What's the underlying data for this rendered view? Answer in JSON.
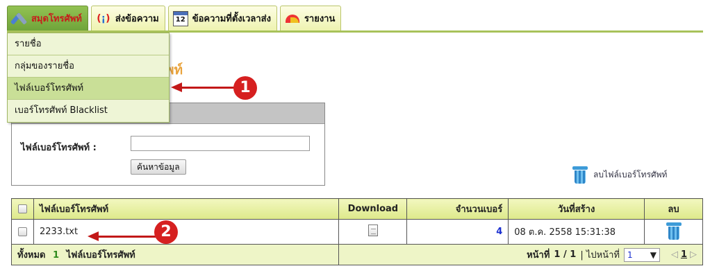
{
  "tabs": [
    {
      "label": "สมุดโทรศัพท์",
      "icon": "tools-icon",
      "active": true
    },
    {
      "label": "ส่งข้อความ",
      "icon": "antenna-icon",
      "active": false
    },
    {
      "label": "ข้อความที่ตั้งเวลาส่ง",
      "icon": "calendar-icon",
      "calendar_day": "12",
      "active": false
    },
    {
      "label": "รายงาน",
      "icon": "chart-icon",
      "active": false
    }
  ],
  "menu": {
    "items": [
      {
        "label": "รายชื่อ"
      },
      {
        "label": "กลุ่มของรายชื่อ"
      },
      {
        "label": "ไฟล์เบอร์โทรศัพท์",
        "highlighted": true
      },
      {
        "label": "เบอร์โทรศัพท์ Blacklist"
      }
    ]
  },
  "page_heading": "พท์",
  "search": {
    "label": "ไฟล์เบอร์โทรศัพท์ :",
    "value": "",
    "button": "ค้นหาข้อมูล"
  },
  "delete_all_label": "ลบไฟล์เบอร์โทรศัพท์",
  "table": {
    "headers": {
      "file": "ไฟล์เบอร์โทรศัพท์",
      "download": "Download",
      "count": "จำนวนเบอร์",
      "created": "วันที่สร้าง",
      "delete": "ลบ"
    },
    "rows": [
      {
        "file": "2233.txt",
        "count": "4",
        "created": "08 ต.ค. 2558 15:31:38"
      }
    ],
    "footer": {
      "total_prefix": "ทั้งหมด",
      "total_count": "1",
      "total_suffix": "ไฟล์เบอร์โทรศัพท์",
      "page_label": "หน้าที่",
      "page_value": "1 / 1",
      "goto_label": "| ไปหน้าที่",
      "goto_value": "1",
      "pager_current": "1"
    }
  },
  "annotations": [
    "1",
    "2"
  ],
  "colors": {
    "arrow": "#c21818",
    "active_tab": "#6fa43a",
    "accent_text": "#e9a33c"
  }
}
